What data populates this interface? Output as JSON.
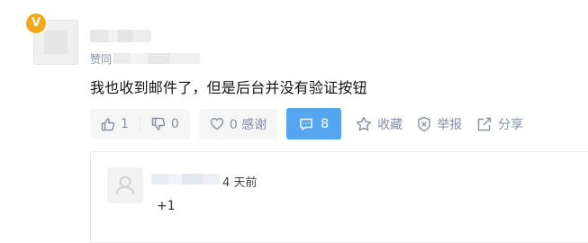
{
  "answer": {
    "verified_badge": "V",
    "meta_prefix": "赞同",
    "text": "我也收到邮件了，但是后台并没有验证按钮"
  },
  "actions": {
    "upvote_count": "1",
    "downvote_count": "0",
    "thanks_label": "0 感谢",
    "comment_count": "8",
    "favorite_label": "收藏",
    "report_label": "举报",
    "share_label": "分享",
    "icons": [
      "thumb-up-icon",
      "thumb-down-icon",
      "heart-icon",
      "comment-icon",
      "star-icon",
      "shield-icon",
      "share-icon"
    ],
    "colors": {
      "comment_button_bg": "#56a6ef",
      "muted_text": "#8590a6",
      "badge": "#f3a71c"
    }
  },
  "comment": {
    "time": "4 天前",
    "text": "+1"
  }
}
